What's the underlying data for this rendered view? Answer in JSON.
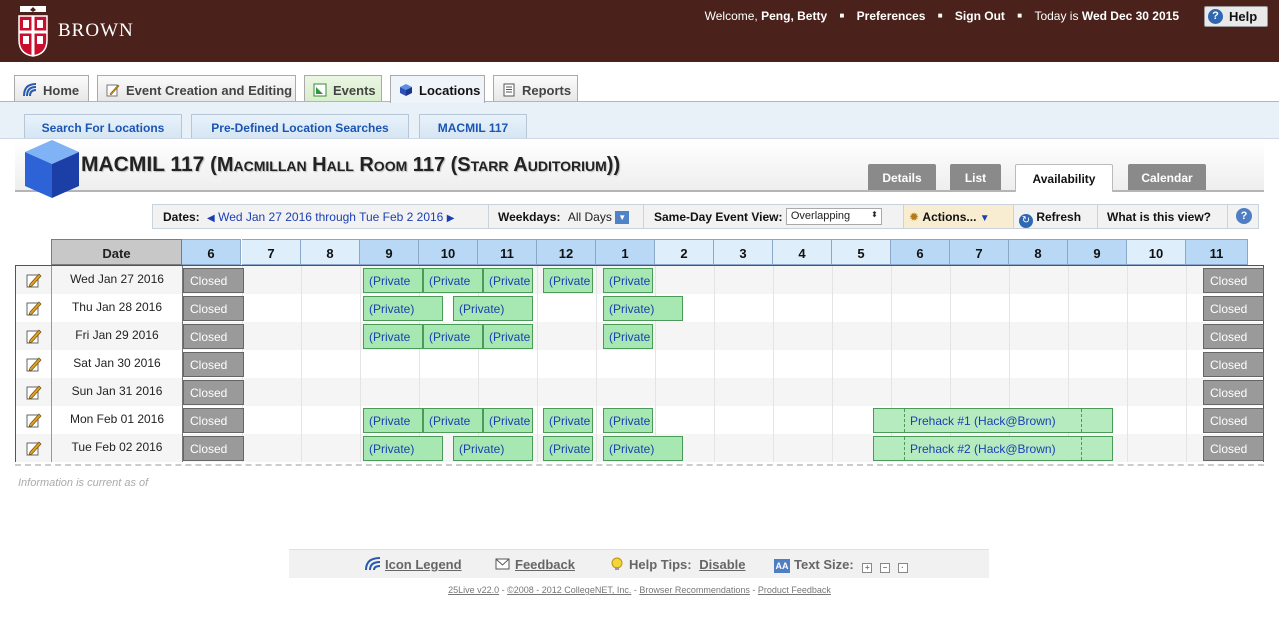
{
  "header": {
    "logo_text": "BROWN",
    "welcome_prefix": "Welcome,",
    "user_name": "Peng, Betty",
    "preferences": "Preferences",
    "sign_out": "Sign Out",
    "today_prefix": "Today is",
    "today_date": "Wed Dec 30 2015",
    "help": "Help"
  },
  "main_tabs": [
    {
      "label": "Home"
    },
    {
      "label": "Event Creation and Editing"
    },
    {
      "label": "Events"
    },
    {
      "label": "Locations"
    },
    {
      "label": "Reports"
    }
  ],
  "sub_tabs": [
    {
      "label": "Search For Locations"
    },
    {
      "label": "Pre-Defined Location Searches"
    },
    {
      "label": "MACMIL 117"
    }
  ],
  "title": {
    "code": "MACMIL 117",
    "name": "(Macmillan Hall Room 117 (Starr Auditorium))"
  },
  "view_tabs": [
    {
      "label": "Details"
    },
    {
      "label": "List"
    },
    {
      "label": "Availability"
    },
    {
      "label": "Calendar"
    }
  ],
  "toolbar": {
    "dates_label": "Dates:",
    "dates_value": "Wed Jan 27 2016 through Tue Feb 2 2016",
    "weekdays_label": "Weekdays:",
    "weekdays_value": "All Days",
    "sameday_label": "Same-Day Event View:",
    "sameday_value": "Overlapping",
    "actions": "Actions...",
    "refresh": "Refresh",
    "what_is": "What is this view?"
  },
  "grid": {
    "date_header": "Date",
    "hours": [
      "6",
      "7",
      "8",
      "9",
      "10",
      "11",
      "12",
      "1",
      "2",
      "3",
      "4",
      "5",
      "6",
      "7",
      "8",
      "9",
      "10",
      "11"
    ],
    "closed_label": "Closed",
    "rows": [
      {
        "date": "Wed Jan 27 2016",
        "events": [
          "(Private",
          "(Private",
          "(Private",
          "(Private",
          "(Private"
        ]
      },
      {
        "date": "Thu Jan 28 2016",
        "events": [
          "(Private)",
          "(Private)",
          "(Private)"
        ]
      },
      {
        "date": "Fri Jan 29 2016",
        "events": [
          "(Private",
          "(Private",
          "(Private",
          "(Private"
        ]
      },
      {
        "date": "Sat Jan 30 2016",
        "events": []
      },
      {
        "date": "Sun Jan 31 2016",
        "events": []
      },
      {
        "date": "Mon Feb 01 2016",
        "events": [
          "(Private",
          "(Private",
          "(Private",
          "(Private",
          "(Private",
          "Prehack #1 (Hack@Brown)"
        ]
      },
      {
        "date": "Tue Feb 02 2016",
        "events": [
          "(Private)",
          "(Private)",
          "(Private",
          "(Private)",
          "Prehack #2 (Hack@Brown)"
        ]
      }
    ]
  },
  "info_note": "Information is current as of",
  "footer": {
    "icon_legend": "Icon Legend",
    "feedback": "Feedback",
    "help_tips_label": "Help Tips:",
    "help_tips_value": "Disable",
    "text_size_label": "Text Size:",
    "version": "25Live v22.0",
    "copyright": "©2008 - 2012 CollegeNET, Inc.",
    "browser_rec": "Browser Recommendations",
    "product_feedback": "Product Feedback"
  }
}
